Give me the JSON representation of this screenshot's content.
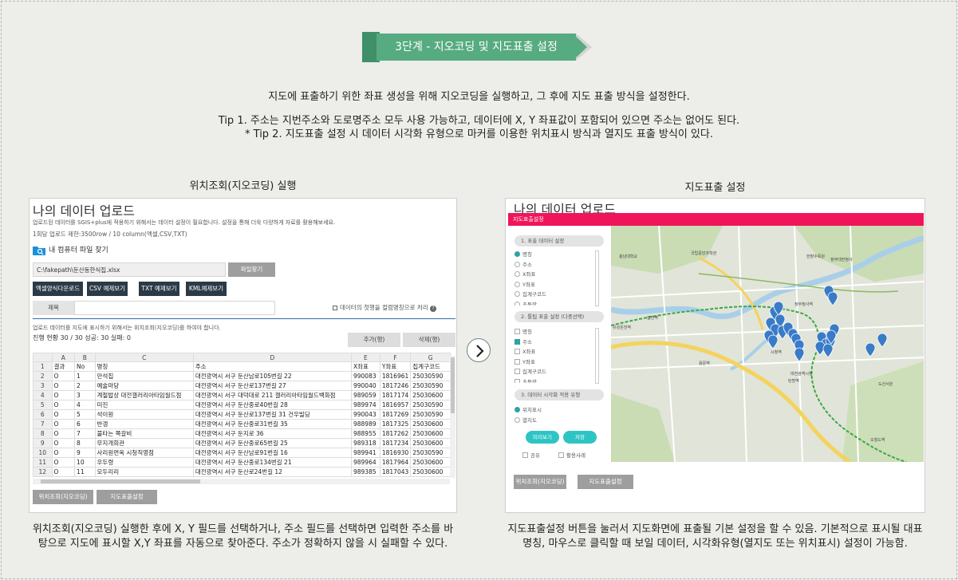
{
  "banner": {
    "title": "3단계 - 지오코딩 및 지도표출 설정"
  },
  "intro": {
    "line1": "지도에 표출하기 위한 좌표 생성을 위해 지오코딩을 실행하고, 그 후에 지도 표출 방식을 설정한다.",
    "tip1": "Tip 1. 주소는 지번주소와 도로명주소 모두 사용 가능하고, 데이터에 X, Y 좌표값이 포함되어 있으면 주소는 없어도 된다.",
    "tip2": "* Tip 2. 지도표출 설정 시 데이터 시각화 유형으로 마커를 이용한 위치표시 방식과 열지도 표출 방식이 있다."
  },
  "left": {
    "heading": "위치조회(지오코딩) 실행",
    "panel_title": "나의 데이터 업로드",
    "desc": "업로드된 데이터를 SGIS+plus에 적용하기 위해서는 데이터 설정이 필요합니다. 설정을 통해 더욱 다양하게 자료를 활용해보세요.",
    "limit": "1회당 업로드 제한:3500row / 10 column(엑셀,CSV,TXT)",
    "folder_label": "내 컴퓨터 파일 찾기",
    "file_path": "C:\\fakepath\\둔산동한식집.xlsx",
    "find_file": "파일찾기",
    "buttons": [
      "엑셀양식다운로드",
      "CSV 예제보기",
      "TXT 예제보기",
      "KML예제보기"
    ],
    "title_label": "제목",
    "first_row_check": "데이터의 첫행을 컬럼명칭으로 처리",
    "geo_desc": "업로드 데이터를 지도에 표시하기 위해서는 위치조회(지오코딩)를 하여야 합니다.",
    "progress": "진행 현황 30 /  30 성공: 30 실패: 0",
    "add_row": "추가(행)",
    "delete_row": "삭제(행)",
    "columns": [
      "",
      "A",
      "B",
      "C",
      "D",
      "E",
      "F",
      "G"
    ],
    "rows": [
      [
        "1",
        "결과",
        "No",
        "명칭",
        "주소",
        "X좌표",
        "Y좌표",
        "집계구코드"
      ],
      [
        "2",
        "O",
        "1",
        "만석집",
        "대전광역시 서구 둔산남로105번길 22",
        "990083",
        "1816961",
        "25030590"
      ],
      [
        "3",
        "O",
        "2",
        "예술마당",
        "대전광역시 서구 둔산로137번길 27",
        "990040",
        "1817246",
        "25030590"
      ],
      [
        "4",
        "O",
        "3",
        "계절밥상 대전갤러리아타임월드점",
        "대전광역시 서구 대덕대로 211 갤러리아타임월드백화점",
        "989059",
        "1817174",
        "25030600"
      ],
      [
        "5",
        "O",
        "4",
        "미진",
        "대전광역시 서구 둔산중로40번길 28",
        "989974",
        "1816957",
        "25030590"
      ],
      [
        "6",
        "O",
        "5",
        "석이원",
        "대전광역시 서구 둔산로137번길 31 건우빌딩",
        "990043",
        "1817269",
        "25030590"
      ],
      [
        "7",
        "O",
        "6",
        "반갱",
        "대전광역시 서구 둔산중로31번길 35",
        "988989",
        "1817325",
        "25030600"
      ],
      [
        "8",
        "O",
        "7",
        "불타는 쪽갈비",
        "대전광역시 서구 둔지로 36",
        "988955",
        "1817262",
        "25030600"
      ],
      [
        "9",
        "O",
        "8",
        "무지개회관",
        "대전광역시 서구 둔산중로65번길 25",
        "989318",
        "1817234",
        "25030600"
      ],
      [
        "10",
        "O",
        "9",
        "사리원면옥 시청직영점",
        "대전광역시 서구 둔산남로91번길 16",
        "989941",
        "1816930",
        "25030590"
      ],
      [
        "11",
        "O",
        "10",
        "우두령",
        "대전광역시 서구 둔산중로134번길 21",
        "989964",
        "1817964",
        "25030600"
      ],
      [
        "12",
        "O",
        "11",
        "모두리리",
        "대전광역시 서구 둔산로24번길 12",
        "989385",
        "1817043",
        "25030600"
      ]
    ],
    "geo_button": "위치조회(지오코딩)",
    "map_button": "지도표출설정"
  },
  "right": {
    "heading": "지도표출 설정",
    "panel_title": "나의 데이터 업로드",
    "bar_title": "지도표출설정",
    "sec1": "1. 표출 데이터 설정",
    "sec1_items": [
      {
        "label": "명칭",
        "on": true
      },
      {
        "label": "주소",
        "on": false
      },
      {
        "label": "X좌표",
        "on": false
      },
      {
        "label": "Y좌표",
        "on": false
      },
      {
        "label": "집계구코드",
        "on": false
      },
      {
        "label": "초등학",
        "on": false
      }
    ],
    "sec2": "2. 툴팁 표출 설정 (다중선택)",
    "sec2_items": [
      {
        "label": "명칭",
        "on": false
      },
      {
        "label": "주소",
        "on": true
      },
      {
        "label": "X좌표",
        "on": false
      },
      {
        "label": "Y좌표",
        "on": false
      },
      {
        "label": "집계구코드",
        "on": false
      },
      {
        "label": "초등학",
        "on": false
      }
    ],
    "sec3": "3. 데이터 시각화 적용 유형",
    "sec3_items": [
      {
        "label": "위치표시",
        "on": true
      },
      {
        "label": "열지도",
        "on": false
      }
    ],
    "preview": "미리보기",
    "save": "저장",
    "share": "공유",
    "use_list": "활용사례",
    "map_labels": [
      "갑천역",
      "유성온천역",
      "정부청사역",
      "시청역",
      "탄방역",
      "용문역",
      "오월드역",
      "대전광역시청",
      "한밭수목원",
      "정부대전청사",
      "도산서원",
      "국립중앙과학관",
      "충남대학교"
    ],
    "geo_button": "위치조회(지오코딩)",
    "map_button": "지도표출설정"
  },
  "captions": {
    "left": "위치조회(지오코딩) 실행한 후에 X, Y 필드를 선택하거나, 주소 필드를 선택하면 입력한 주소를 바탕으로 지도에 표시할 X,Y 좌표를 자동으로 찾아준다. 주소가 정확하지 않을 시 실패할 수 있다.",
    "right": "지도표출설정 버튼을 눌러서 지도화면에 표출될 기본 설정을 할 수 있음. 기본적으로 표시될 대표명칭, 마우스로 클릭할 때 보일 데이터, 시각화유형(열지도 또는 위치표시) 설정이 가능함."
  },
  "colors": {
    "banner": "#57ab80",
    "bar": "#f0145a",
    "button_dark": "#2c3a48",
    "teal": "#2fa3a3"
  }
}
